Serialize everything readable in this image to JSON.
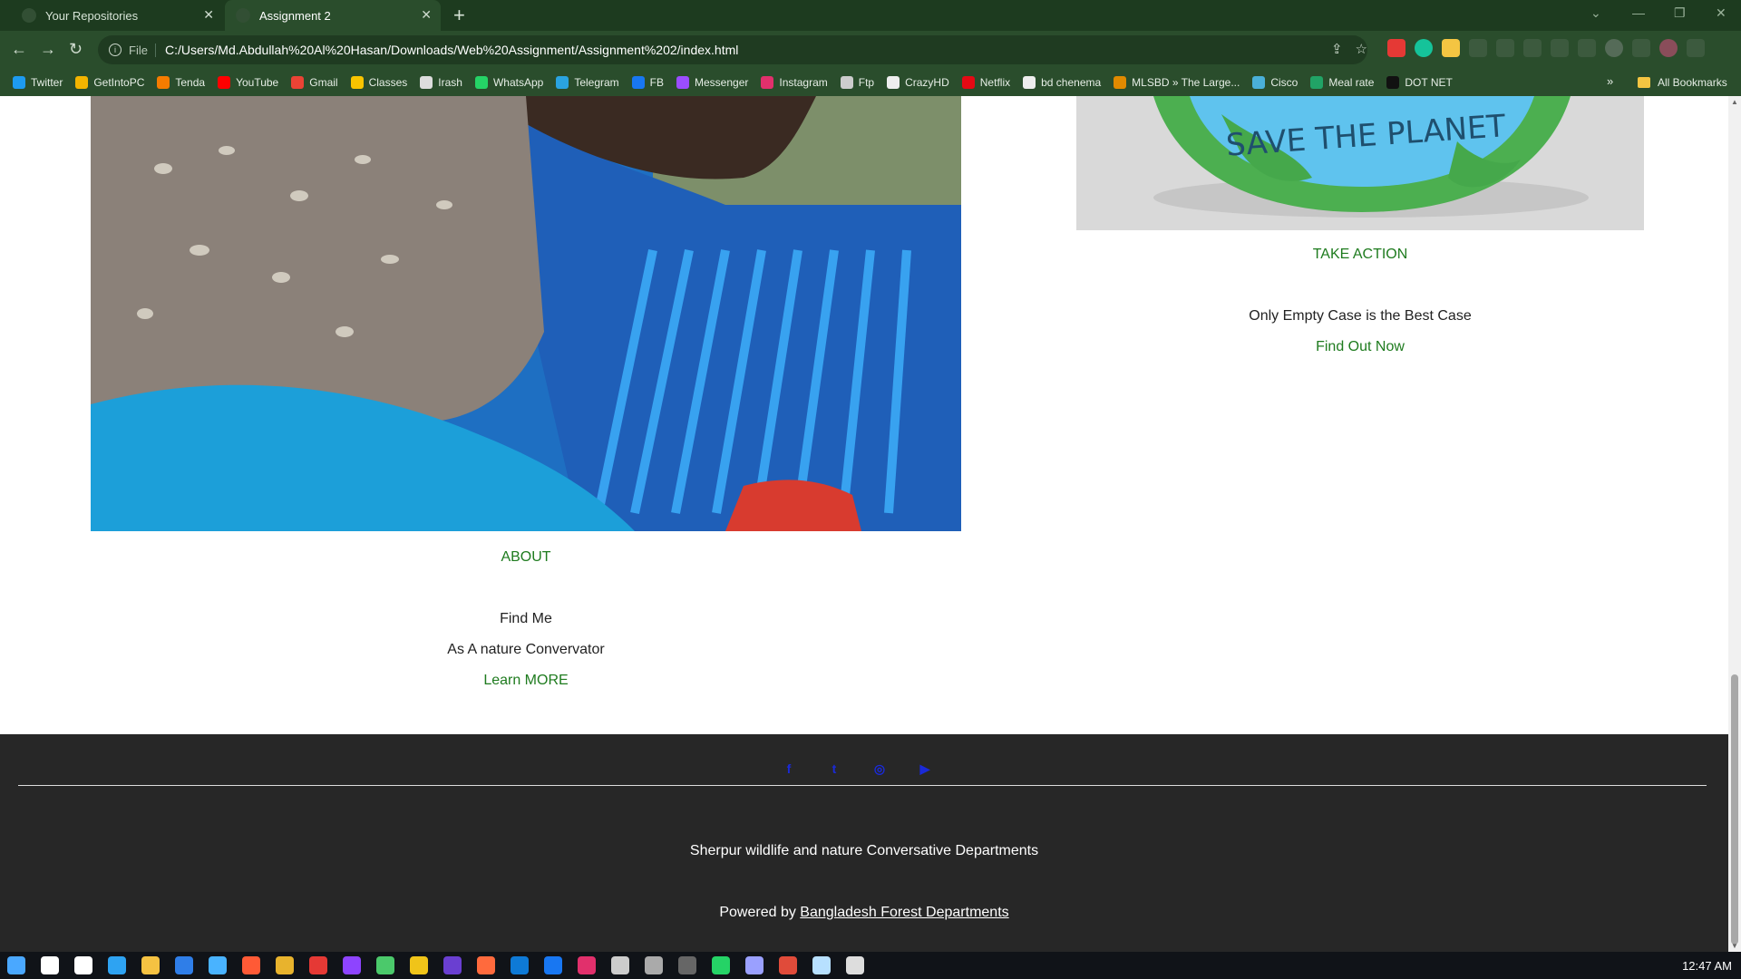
{
  "browser": {
    "tabs": [
      {
        "title": "Your Repositories",
        "active": false
      },
      {
        "title": "Assignment 2",
        "active": true
      }
    ],
    "address": {
      "scheme": "File",
      "url": "C:/Users/Md.Abdullah%20Al%20Hasan/Downloads/Web%20Assignment/Assignment%202/index.html"
    },
    "bookmarks": [
      {
        "label": "Twitter",
        "color": "#1d9bf0"
      },
      {
        "label": "GetIntoPC",
        "color": "#f3b400"
      },
      {
        "label": "Tenda",
        "color": "#f57c00"
      },
      {
        "label": "YouTube",
        "color": "#ff0000"
      },
      {
        "label": "Gmail",
        "color": "#ea4335"
      },
      {
        "label": "Classes",
        "color": "#f9c400"
      },
      {
        "label": "Irash",
        "color": "#dddddd"
      },
      {
        "label": "WhatsApp",
        "color": "#25d366"
      },
      {
        "label": "Telegram",
        "color": "#2aa3e0"
      },
      {
        "label": "FB",
        "color": "#1877f2"
      },
      {
        "label": "Messenger",
        "color": "#9b4dff"
      },
      {
        "label": "Instagram",
        "color": "#e1306c"
      },
      {
        "label": "Ftp",
        "color": "#cccccc"
      },
      {
        "label": "CrazyHD",
        "color": "#eeeeee"
      },
      {
        "label": "Netflix",
        "color": "#e50914"
      },
      {
        "label": "bd chenema",
        "color": "#eeeeee"
      },
      {
        "label": "MLSBD » The Large...",
        "color": "#e08a00"
      },
      {
        "label": "Cisco",
        "color": "#4ab0d9"
      },
      {
        "label": "Meal rate",
        "color": "#21a366"
      },
      {
        "label": "DOT NET",
        "color": "#111111"
      }
    ],
    "bookmarks_more": "»",
    "all_bookmarks": "All Bookmarks"
  },
  "page": {
    "about": {
      "heading": "ABOUT",
      "line1": "Find Me",
      "line2": "As A nature Convervator",
      "link": "Learn MORE"
    },
    "take_action": {
      "heading": "TAKE ACTION",
      "line1": "Only Empty Case is the Best Case",
      "link": "Find Out Now"
    },
    "planet_text": "SAVE THE PLANET"
  },
  "footer": {
    "social": [
      "f",
      "t",
      "◎",
      "▶"
    ],
    "line1": "Sherpur wildlife and nature Conversative Departments",
    "powered_prefix": "Powered by",
    "powered_link": "Bangladesh Forest Departments"
  },
  "taskbar": {
    "clock": "12:47 AM",
    "icons": [
      "#4aa8ff",
      "#ffffff",
      "#ffffff",
      "#2ea3f2",
      "#f5c242",
      "#2f7ee8",
      "#49b3ff",
      "#ff5a36",
      "#e8b32d",
      "#e53935",
      "#8e44ff",
      "#4bc96b",
      "#f0c419",
      "#6a3fd1",
      "#ff6a3d",
      "#0e7ad6",
      "#1877f2",
      "#e1306c",
      "#cccccc",
      "#aaaaaa",
      "#666666",
      "#25d366",
      "#9aa0ff",
      "#e04b3a",
      "#b7e0ff",
      "#dddddd"
    ]
  }
}
